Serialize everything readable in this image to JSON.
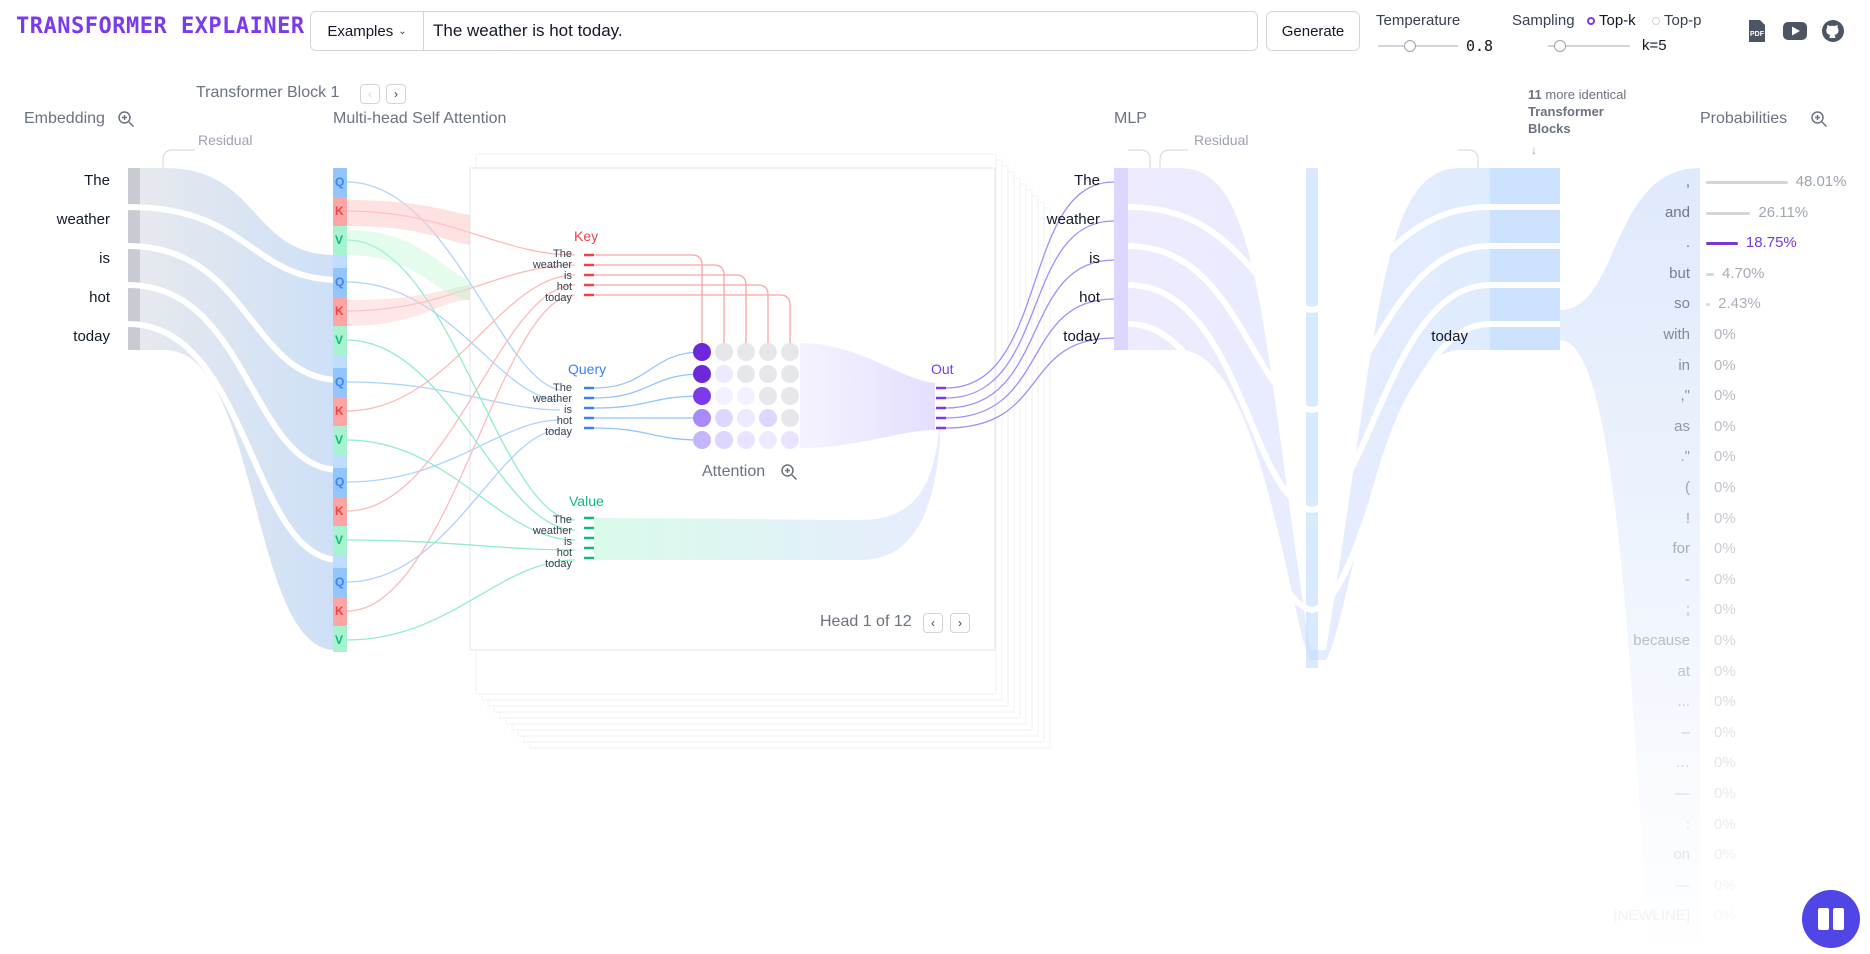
{
  "header": {
    "logo": "TRANSFORMER EXPLAINER",
    "examples_label": "Examples",
    "prompt": "The weather is hot today.",
    "generate_label": "Generate",
    "temperature_label": "Temperature",
    "temperature_value": "0.8",
    "sampling_label": "Sampling",
    "topk_label": "Top-k",
    "topp_label": "Top-p",
    "k_value": "k=5",
    "icons": [
      "pdf-icon",
      "youtube-icon",
      "github-icon"
    ]
  },
  "sections": {
    "block_title": "Transformer Block 1",
    "embedding": "Embedding",
    "attention": "Multi-head Self Attention",
    "residual": "Residual",
    "mlp": "MLP",
    "probabilities": "Probabilities",
    "identical_count": "11",
    "identical_text": "more identical",
    "identical_text2": "Transformer",
    "identical_text3": "Blocks"
  },
  "tokens": [
    "The",
    "weather",
    "is",
    "hot",
    "today"
  ],
  "attention_panel": {
    "key": "Key",
    "query": "Query",
    "value": "Value",
    "out": "Out",
    "attention": "Attention",
    "head": "Head 1 of 12"
  },
  "mlp_output_token": "today",
  "probabilities": [
    {
      "token": ",",
      "value": "48.01%",
      "p": 0.4801
    },
    {
      "token": "and",
      "value": "26.11%",
      "p": 0.2611
    },
    {
      "token": ".",
      "value": "18.75%",
      "p": 0.1875
    },
    {
      "token": "but",
      "value": "4.70%",
      "p": 0.047
    },
    {
      "token": "so",
      "value": "2.43%",
      "p": 0.0243
    },
    {
      "token": "with",
      "value": "0%",
      "p": 0
    },
    {
      "token": "in",
      "value": "0%",
      "p": 0
    },
    {
      "token": ",\"",
      "value": "0%",
      "p": 0
    },
    {
      "token": "as",
      "value": "0%",
      "p": 0
    },
    {
      "token": ".\"",
      "value": "0%",
      "p": 0
    },
    {
      "token": "(",
      "value": "0%",
      "p": 0
    },
    {
      "token": "!",
      "value": "0%",
      "p": 0
    },
    {
      "token": "for",
      "value": "0%",
      "p": 0
    },
    {
      "token": "-",
      "value": "0%",
      "p": 0
    },
    {
      "token": ";",
      "value": "0%",
      "p": 0
    },
    {
      "token": "because",
      "value": "0%",
      "p": 0
    },
    {
      "token": "at",
      "value": "0%",
      "p": 0
    },
    {
      "token": "...",
      "value": "0%",
      "p": 0
    },
    {
      "token": "–",
      "value": "0%",
      "p": 0
    },
    {
      "token": "…",
      "value": "0%",
      "p": 0
    },
    {
      "token": "—",
      "value": "0%",
      "p": 0
    },
    {
      "token": ":",
      "value": "0%",
      "p": 0
    },
    {
      "token": "on",
      "value": "0%",
      "p": 0
    },
    {
      "token": "—",
      "value": "0%",
      "p": 0
    },
    {
      "token": "[NEWLINE]",
      "value": "0%",
      "p": 0
    }
  ],
  "colors": {
    "accent": "#7c3aed",
    "query": "#3b82f6",
    "key": "#ef4444",
    "value": "#10b981",
    "embedding_band": "#dbeafe",
    "fab": "#4f46e5"
  }
}
